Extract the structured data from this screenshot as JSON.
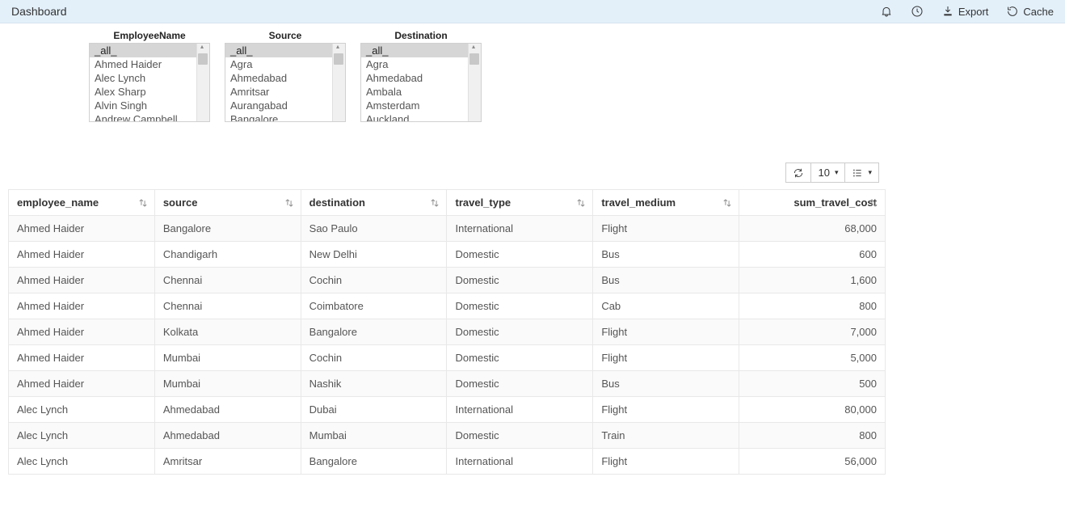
{
  "header": {
    "title": "Dashboard",
    "export_label": "Export",
    "cache_label": "Cache"
  },
  "filters": [
    {
      "label": "EmployeeName",
      "all": "_all_",
      "items": [
        "Ahmed Haider",
        "Alec Lynch",
        "Alex Sharp",
        "Alvin Singh",
        "Andrew Campbell"
      ]
    },
    {
      "label": "Source",
      "all": "_all_",
      "items": [
        "Agra",
        "Ahmedabad",
        "Amritsar",
        "Aurangabad",
        "Bangalore"
      ]
    },
    {
      "label": "Destination",
      "all": "_all_",
      "items": [
        "Agra",
        "Ahmedabad",
        "Ambala",
        "Amsterdam",
        "Auckland"
      ]
    }
  ],
  "toolbar": {
    "page_size": "10"
  },
  "table": {
    "columns": [
      {
        "key": "employee_name",
        "label": "employee_name",
        "num": false
      },
      {
        "key": "source",
        "label": "source",
        "num": false
      },
      {
        "key": "destination",
        "label": "destination",
        "num": false
      },
      {
        "key": "travel_type",
        "label": "travel_type",
        "num": false
      },
      {
        "key": "travel_medium",
        "label": "travel_medium",
        "num": false
      },
      {
        "key": "sum_travel_cost",
        "label": "sum_travel_cost",
        "num": true
      }
    ],
    "rows": [
      {
        "employee_name": "Ahmed Haider",
        "source": "Bangalore",
        "destination": "Sao Paulo",
        "travel_type": "International",
        "travel_medium": "Flight",
        "sum_travel_cost": "68,000"
      },
      {
        "employee_name": "Ahmed Haider",
        "source": "Chandigarh",
        "destination": "New Delhi",
        "travel_type": "Domestic",
        "travel_medium": "Bus",
        "sum_travel_cost": "600"
      },
      {
        "employee_name": "Ahmed Haider",
        "source": "Chennai",
        "destination": "Cochin",
        "travel_type": "Domestic",
        "travel_medium": "Bus",
        "sum_travel_cost": "1,600"
      },
      {
        "employee_name": "Ahmed Haider",
        "source": "Chennai",
        "destination": "Coimbatore",
        "travel_type": "Domestic",
        "travel_medium": "Cab",
        "sum_travel_cost": "800"
      },
      {
        "employee_name": "Ahmed Haider",
        "source": "Kolkata",
        "destination": "Bangalore",
        "travel_type": "Domestic",
        "travel_medium": "Flight",
        "sum_travel_cost": "7,000"
      },
      {
        "employee_name": "Ahmed Haider",
        "source": "Mumbai",
        "destination": "Cochin",
        "travel_type": "Domestic",
        "travel_medium": "Flight",
        "sum_travel_cost": "5,000"
      },
      {
        "employee_name": "Ahmed Haider",
        "source": "Mumbai",
        "destination": "Nashik",
        "travel_type": "Domestic",
        "travel_medium": "Bus",
        "sum_travel_cost": "500"
      },
      {
        "employee_name": "Alec Lynch",
        "source": "Ahmedabad",
        "destination": "Dubai",
        "travel_type": "International",
        "travel_medium": "Flight",
        "sum_travel_cost": "80,000"
      },
      {
        "employee_name": "Alec Lynch",
        "source": "Ahmedabad",
        "destination": "Mumbai",
        "travel_type": "Domestic",
        "travel_medium": "Train",
        "sum_travel_cost": "800"
      },
      {
        "employee_name": "Alec Lynch",
        "source": "Amritsar",
        "destination": "Bangalore",
        "travel_type": "International",
        "travel_medium": "Flight",
        "sum_travel_cost": "56,000"
      }
    ]
  }
}
